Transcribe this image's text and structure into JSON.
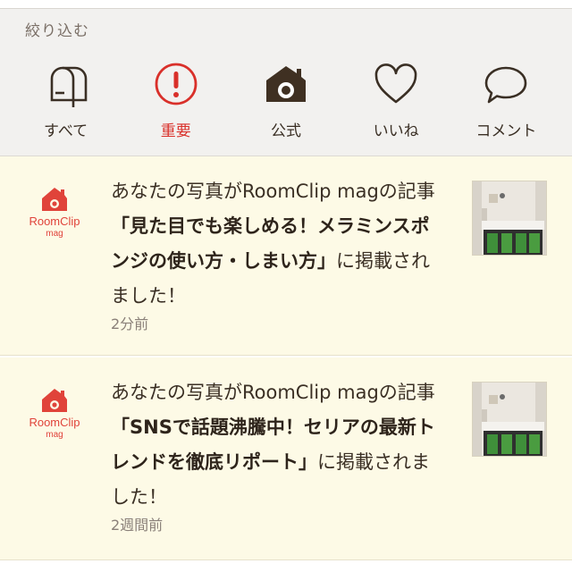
{
  "filter": {
    "title": "絞り込む",
    "tabs": [
      {
        "label": "すべて",
        "icon": "mailbox-icon",
        "active": false
      },
      {
        "label": "重要",
        "icon": "exclamation-icon",
        "active": true
      },
      {
        "label": "公式",
        "icon": "camera-house-icon",
        "active": false
      },
      {
        "label": "いいね",
        "icon": "heart-icon",
        "active": false
      },
      {
        "label": "コメント",
        "icon": "speech-bubble-icon",
        "active": false
      }
    ],
    "active_color": "#d9302a"
  },
  "feed": {
    "items": [
      {
        "text_before": "あなたの写真がRoomClip magの記事",
        "title": "「見た目でも楽しめる！メラミンスポンジの使い方・しまい方」",
        "text_after": "に掲載されました！",
        "time": "2分前",
        "logo_name": "RoomClip",
        "logo_sub": "mag"
      },
      {
        "text_before": "あなたの写真がRoomClip magの記事",
        "title": "「SNSで話題沸騰中！セリアの最新トレンドを徹底リポート」",
        "text_after": "に掲載されました！",
        "time": "2週間前",
        "logo_name": "RoomClip",
        "logo_sub": "mag"
      }
    ],
    "background": "#fdfae6",
    "logo_color": "#e0433a"
  }
}
